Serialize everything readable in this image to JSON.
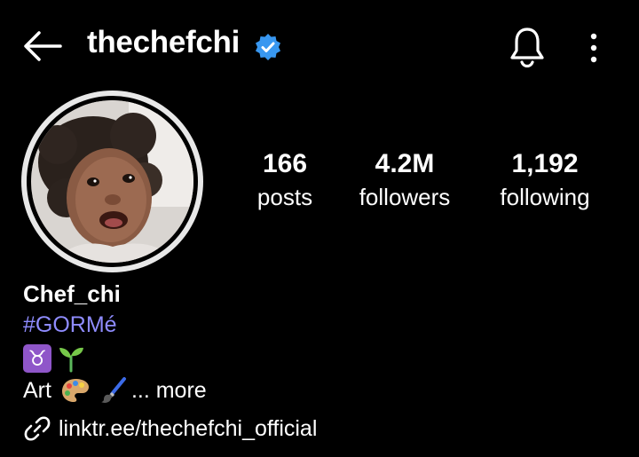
{
  "header": {
    "username": "thechefchi",
    "back_icon": "arrow-left-icon",
    "verified_icon": "verified-badge-icon",
    "notifications_icon": "bell-icon",
    "menu_icon": "more-vertical-icon"
  },
  "profile": {
    "avatar_icon": "profile-photo",
    "stats": [
      {
        "value": "166",
        "label": "posts"
      },
      {
        "value": "4.2M",
        "label": "followers"
      },
      {
        "value": "1,192",
        "label": "following"
      }
    ]
  },
  "bio": {
    "name": "Chef_chi",
    "hashtag": "#GORMé",
    "taurus": "♉",
    "seedling": "🌱",
    "art_text": "Art",
    "art_emojis": "🎨 🖌️",
    "more_label": "... more",
    "link": "linktr.ee/thechefchi_official"
  },
  "colors": {
    "background": "#000000",
    "text": "#ffffff",
    "hashtag": "#8f8cff",
    "verified": "#3897f0"
  }
}
